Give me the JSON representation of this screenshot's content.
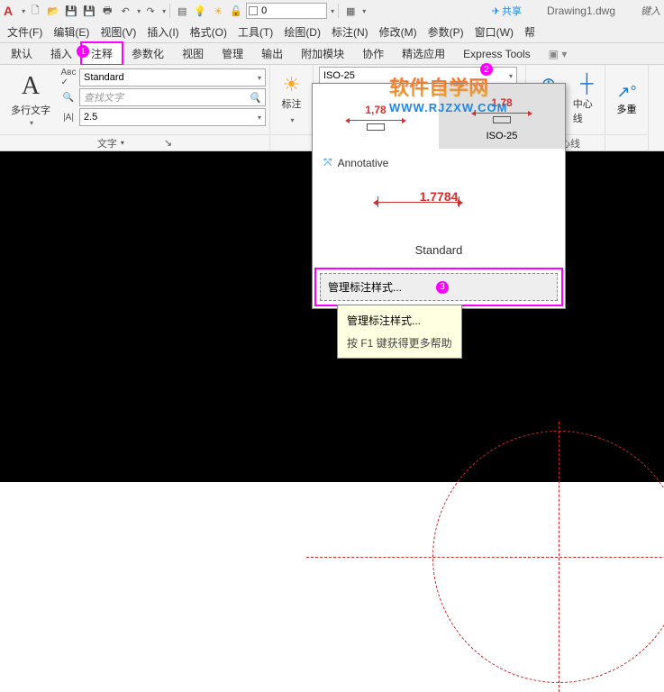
{
  "qat": {
    "logo": "A",
    "layer_value": "0",
    "share": "共享",
    "title": "Drawing1.dwg",
    "key_hint": "键入"
  },
  "menubar": {
    "items": [
      "文件(F)",
      "编辑(E)",
      "视图(V)",
      "插入(I)",
      "格式(O)",
      "工具(T)",
      "绘图(D)",
      "标注(N)",
      "修改(M)",
      "参数(P)",
      "窗口(W)",
      "帮"
    ]
  },
  "tabs": {
    "items": [
      "默认",
      "插入",
      "注释",
      "参数化",
      "视图",
      "管理",
      "输出",
      "附加模块",
      "协作",
      "精选应用",
      "Express Tools"
    ],
    "active_index": 2,
    "badge1": "1",
    "end": "▣ ▾"
  },
  "ribbon": {
    "text_panel": {
      "big_label": "多行文字",
      "style": "Standard",
      "search_placeholder": "查找文字",
      "height": "2.5",
      "title": "文字"
    },
    "dim_panel": {
      "label": "标注",
      "style": "ISO-25"
    },
    "center_panel": {
      "item1": "圆心标记",
      "item2": "中心线",
      "title": "中心线"
    },
    "more_panel": {
      "label": "多重"
    }
  },
  "badge2": "2",
  "dimstyle_dropdown": {
    "preview_val": "1,78",
    "iso_name": "ISO-25",
    "annotative": "Annotative",
    "big_preview_val": "1.7784",
    "standard": "Standard",
    "manage": "管理标注样式...",
    "badge3": "3"
  },
  "tooltip": {
    "title": "管理标注样式...",
    "help": "按 F1 键获得更多帮助"
  },
  "watermark": {
    "line1": "软件自学网",
    "line2": "WWW.RJZXW.COM"
  }
}
